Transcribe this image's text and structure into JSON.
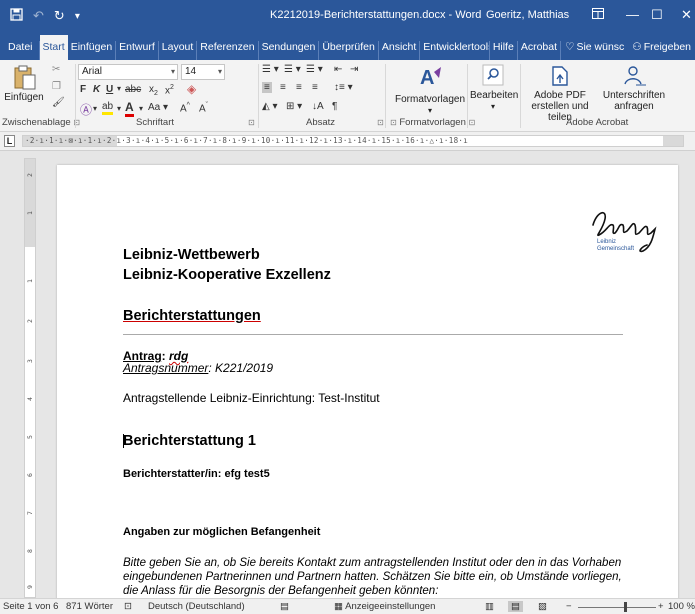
{
  "window": {
    "title": "K2212019-Berichterstattungen.docx - Word",
    "user": "Goeritz, Matthias"
  },
  "tabs": [
    "Datei",
    "Start",
    "Einfügen",
    "Entwurf",
    "Layout",
    "Referenzen",
    "Sendungen",
    "Überprüfen",
    "Ansicht",
    "Entwicklertools",
    "Hilfe",
    "Acrobat"
  ],
  "active_tab": "Start",
  "tell_me": "Sie wünsc",
  "share": "Freigeben",
  "ribbon": {
    "clipboard": {
      "paste": "Einfügen",
      "label": "Zwischenablage"
    },
    "font": {
      "name": "Arial",
      "size": "14",
      "label": "Schriftart",
      "aa": "Aa"
    },
    "paragraph": {
      "label": "Absatz"
    },
    "styles": {
      "button": "Formatvorlagen",
      "label": "Formatvorlagen"
    },
    "editing": {
      "button": "Bearbeiten"
    },
    "acrobat": {
      "pdf_line1": "Adobe PDF",
      "pdf_line2": "erstellen und teilen",
      "sign_line1": "Unterschriften",
      "sign_line2": "anfragen",
      "label": "Adobe Acrobat"
    }
  },
  "document": {
    "org1": "Leibniz-Wettbewerb",
    "org2": "Leibniz-Kooperative Exzellenz",
    "section": "Berichterstattungen",
    "antrag_label": "Antrag",
    "antrag_value": "rdg",
    "antragsnummer_label": "Antragsnummer",
    "antragsnummer_value": "K221/2019",
    "institute_line": "Antragstellende Leibniz-Einrichtung: Test-Institut",
    "report_heading": "Berichterstattung 1",
    "reporter_line": "Berichterstatter/in: efg test5",
    "bias_heading": "Angaben zur möglichen Befangenheit",
    "bias_text": "Bitte geben Sie an, ob Sie bereits Kontakt zum antragstellenden Institut oder den in das Vorhaben eingebundenen Partnerinnen und Partnern hatten. Schätzen Sie bitte ein, ob Umstände vorliegen, die Anlass für die Besorgnis der Befangenheit geben könnten:",
    "logo": {
      "word": "Leibniz",
      "line1": "Leibniz",
      "line2": "Gemeinschaft"
    }
  },
  "statusbar": {
    "page": "Seite 1 von 6",
    "words": "871 Wörter",
    "language": "Deutsch (Deutschland)",
    "display_settings": "Anzeigeeinstellungen",
    "zoom": "100 %"
  },
  "colors": {
    "accent": "#2b579a"
  }
}
